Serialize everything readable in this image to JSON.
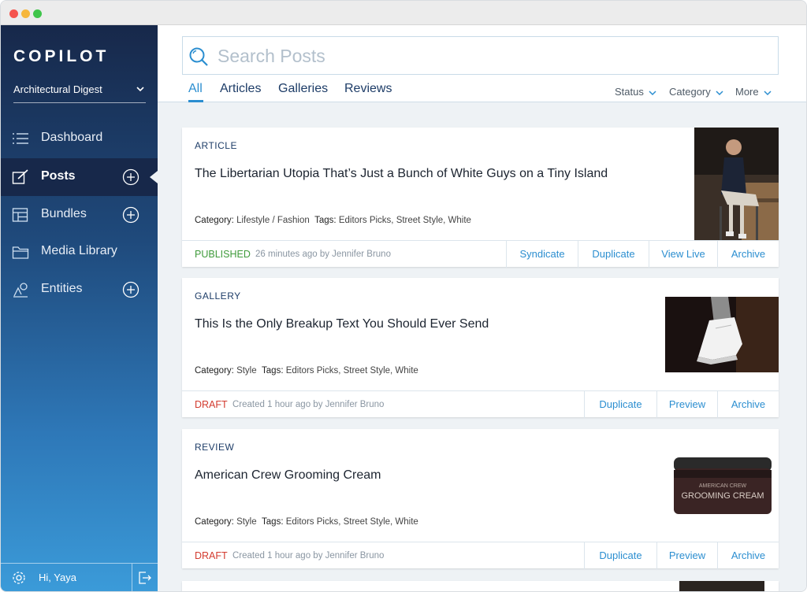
{
  "window": {
    "title": ""
  },
  "sidebar": {
    "logo": "COPILOT",
    "brand": "Architectural Digest",
    "items": [
      {
        "label": "Dashboard",
        "icon": "dashboard-icon",
        "has_add": false,
        "active": false
      },
      {
        "label": "Posts",
        "icon": "edit-icon",
        "has_add": true,
        "active": true
      },
      {
        "label": "Bundles",
        "icon": "bundles-icon",
        "has_add": true,
        "active": false
      },
      {
        "label": "Media Library",
        "icon": "folder-icon",
        "has_add": false,
        "active": false
      },
      {
        "label": "Entities",
        "icon": "entities-icon",
        "has_add": true,
        "active": false
      }
    ],
    "footer": {
      "greeting": "Hi, Yaya"
    }
  },
  "search": {
    "placeholder": "Search Posts",
    "value": ""
  },
  "tabs": [
    "All",
    "Articles",
    "Galleries",
    "Reviews"
  ],
  "active_tab": "All",
  "filters": [
    "Status",
    "Category",
    "More"
  ],
  "posts": [
    {
      "type": "ARTICLE",
      "title": "The Libertarian Utopia That’s Just a Bunch of White Guys on a Tiny Island",
      "category_label": "Category:",
      "category": "Lifestyle / Fashion",
      "tags_label": "Tags:",
      "tags": "Editors Picks, Street Style, White",
      "status": "PUBLISHED",
      "status_kind": "published",
      "timestamp": "26 minutes ago by Jennifer Bruno",
      "actions": [
        "Syndicate",
        "Duplicate",
        "View Live",
        "Archive"
      ],
      "thumbnail": "man-seated-photo"
    },
    {
      "type": "GALLERY",
      "title": "This Is the Only Breakup Text You Should Ever Send",
      "category_label": "Category:",
      "category": "Style",
      "tags_label": "Tags:",
      "tags": "Editors Picks, Street Style, White",
      "status": "DRAFT",
      "status_kind": "draft",
      "timestamp": "Created 1 hour ago by Jennifer Bruno",
      "actions": [
        "Duplicate",
        "Preview",
        "Archive"
      ],
      "thumbnail": "sneaker-photo"
    },
    {
      "type": "REVIEW",
      "title": "American Crew Grooming Cream",
      "category_label": "Category:",
      "category": "Style",
      "tags_label": "Tags:",
      "tags": "Editors Picks, Street Style, White",
      "status": "DRAFT",
      "status_kind": "draft",
      "timestamp": "Created 1 hour ago by Jennifer Bruno",
      "actions": [
        "Duplicate",
        "Preview",
        "Archive"
      ],
      "thumbnail": "grooming-cream-photo",
      "product_label_top": "AMERICAN CREW",
      "product_label_main": "GROOMING CREAM"
    }
  ],
  "colors": {
    "accent": "#2b8ed0",
    "navy": "#1d3c67",
    "published": "#3f9b3b",
    "draft": "#d33b2f"
  }
}
